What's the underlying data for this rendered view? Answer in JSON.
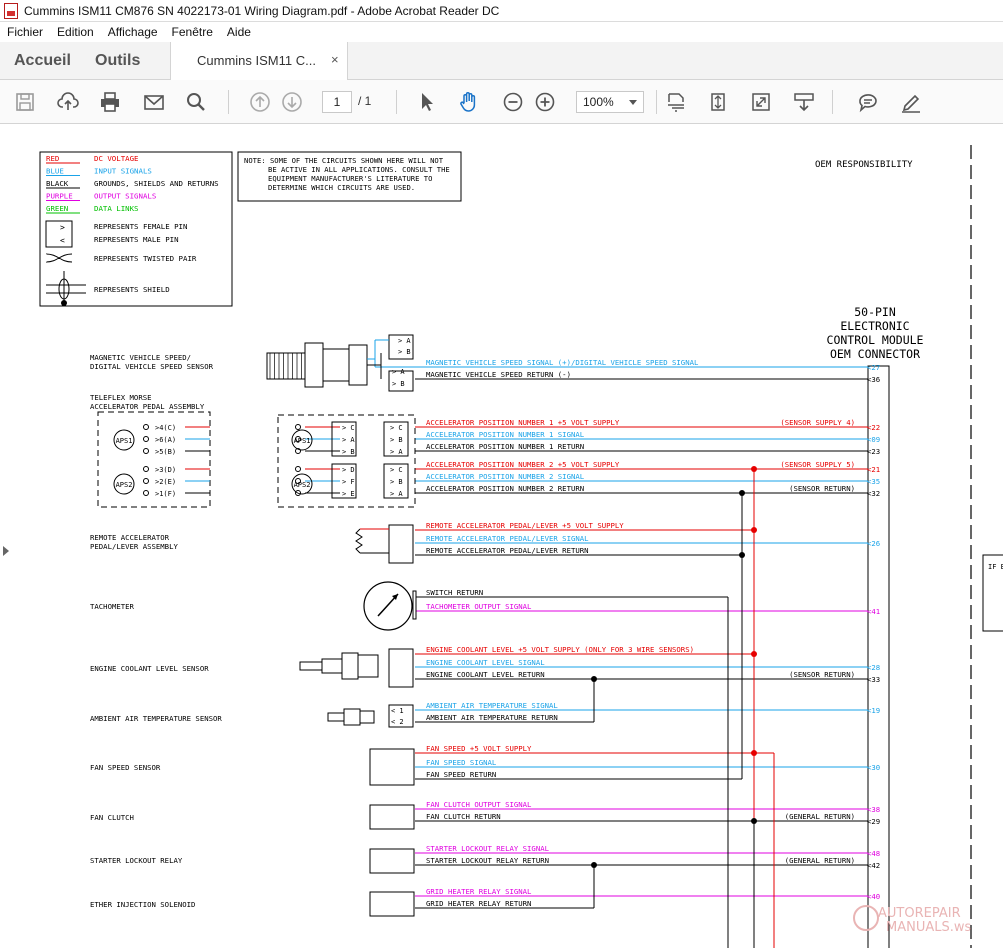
{
  "window": {
    "title": "Cummins ISM11 CM876 SN 4022173-01 Wiring Diagram.pdf - Adobe Acrobat Reader DC"
  },
  "menu": [
    "Fichier",
    "Edition",
    "Affichage",
    "Fenêtre",
    "Aide"
  ],
  "tabs": {
    "home": "Accueil",
    "tools": "Outils",
    "document": "Cummins ISM11 C...",
    "close": "×"
  },
  "toolbar": {
    "page_current": "1",
    "page_total": "/ 1",
    "zoom": "100%"
  },
  "legend": {
    "colors": [
      {
        "name": "RED",
        "meaning": "DC VOLTAGE",
        "hex": "#e60000"
      },
      {
        "name": "BLUE",
        "meaning": "INPUT SIGNALS",
        "hex": "#1aa3e8"
      },
      {
        "name": "BLACK",
        "meaning": "GROUNDS, SHIELDS AND RETURNS",
        "hex": "#000000"
      },
      {
        "name": "PURPLE",
        "meaning": "OUTPUT SIGNALS",
        "hex": "#e000e0"
      },
      {
        "name": "GREEN",
        "meaning": "DATA LINKS",
        "hex": "#00c000"
      }
    ],
    "symbols": [
      "REPRESENTS FEMALE PIN",
      "REPRESENTS MALE PIN",
      "REPRESENTS TWISTED PAIR",
      "REPRESENTS SHIELD"
    ]
  },
  "note": [
    "NOTE: SOME OF THE CIRCUITS SHOWN HERE WILL NOT",
    "BE ACTIVE IN ALL APPLICATIONS. CONSULT THE",
    "EQUIPMENT MANUFACTURER'S LITERATURE TO",
    "DETERMINE WHICH CIRCUITS ARE USED."
  ],
  "oem_responsibility": "OEM RESPONSIBILITY",
  "connector_title": [
    "50-PIN",
    "ELECTRONIC",
    "CONTROL MODULE",
    "OEM CONNECTOR"
  ],
  "components": [
    [
      "MAGNETIC VEHICLE SPEED/",
      "DIGITAL VEHICLE SPEED SENSOR"
    ],
    [
      "TELEFLEX MORSE",
      "ACCELERATOR PEDAL ASSEMBLY"
    ],
    [
      "REMOTE ACCELERATOR",
      "PEDAL/LEVER ASSEMBLY"
    ],
    [
      "TACHOMETER"
    ],
    [
      "ENGINE COOLANT LEVEL SENSOR"
    ],
    [
      "AMBIENT AIR TEMPERATURE SENSOR"
    ],
    [
      "FAN SPEED SENSOR"
    ],
    [
      "FAN CLUTCH"
    ],
    [
      "STARTER LOCKOUT RELAY"
    ],
    [
      "ETHER INJECTION SOLENOID"
    ]
  ],
  "wires": [
    {
      "label": "MAGNETIC VEHICLE SPEED SIGNAL (+)/DIGITAL VEHICLE SPEED SIGNAL",
      "color": "blue",
      "pin": "<27",
      "note": ""
    },
    {
      "label": "MAGNETIC VEHICLE SPEED RETURN (-)",
      "color": "black",
      "pin": "<36",
      "note": ""
    },
    {
      "label": "ACCELERATOR POSITION NUMBER 1 +5 VOLT SUPPLY",
      "color": "red",
      "pin": "<22",
      "note": "(SENSOR SUPPLY 4)"
    },
    {
      "label": "ACCELERATOR POSITION NUMBER 1 SIGNAL",
      "color": "blue",
      "pin": "<09",
      "note": ""
    },
    {
      "label": "ACCELERATOR POSITION NUMBER 1 RETURN",
      "color": "black",
      "pin": "<23",
      "note": ""
    },
    {
      "label": "ACCELERATOR POSITION NUMBER 2 +5 VOLT SUPPLY",
      "color": "red",
      "pin": "<21",
      "note": "(SENSOR SUPPLY 5)"
    },
    {
      "label": "ACCELERATOR POSITION NUMBER 2 SIGNAL",
      "color": "blue",
      "pin": "<35",
      "note": ""
    },
    {
      "label": "ACCELERATOR POSITION NUMBER 2 RETURN",
      "color": "black",
      "pin": "<32",
      "note": "(SENSOR RETURN)"
    },
    {
      "label": "REMOTE ACCELERATOR PEDAL/LEVER +5 VOLT SUPPLY",
      "color": "red",
      "pin": "",
      "note": ""
    },
    {
      "label": "REMOTE ACCELERATOR PEDAL/LEVER SIGNAL",
      "color": "blue",
      "pin": "<26",
      "note": ""
    },
    {
      "label": "REMOTE ACCELERATOR PEDAL/LEVER RETURN",
      "color": "black",
      "pin": "",
      "note": ""
    },
    {
      "label": "SWITCH RETURN",
      "color": "black",
      "pin": "",
      "note": ""
    },
    {
      "label": "TACHOMETER OUTPUT SIGNAL",
      "color": "purple",
      "pin": "<41",
      "note": ""
    },
    {
      "label": "ENGINE COOLANT LEVEL +5 VOLT SUPPLY (ONLY FOR 3 WIRE SENSORS)",
      "color": "red",
      "pin": "",
      "note": ""
    },
    {
      "label": "ENGINE COOLANT LEVEL SIGNAL",
      "color": "blue",
      "pin": "<28",
      "note": ""
    },
    {
      "label": "ENGINE COOLANT LEVEL RETURN",
      "color": "black",
      "pin": "<33",
      "note": "(SENSOR RETURN)"
    },
    {
      "label": "AMBIENT AIR TEMPERATURE SIGNAL",
      "color": "blue",
      "pin": "<19",
      "note": ""
    },
    {
      "label": "AMBIENT AIR TEMPERATURE RETURN",
      "color": "black",
      "pin": "",
      "note": ""
    },
    {
      "label": "FAN SPEED +5 VOLT SUPPLY",
      "color": "red",
      "pin": "",
      "note": ""
    },
    {
      "label": "FAN SPEED SIGNAL",
      "color": "blue",
      "pin": "<30",
      "note": ""
    },
    {
      "label": "FAN SPEED RETURN",
      "color": "black",
      "pin": "",
      "note": ""
    },
    {
      "label": "FAN CLUTCH OUTPUT SIGNAL",
      "color": "purple",
      "pin": "<38",
      "note": ""
    },
    {
      "label": "FAN CLUTCH RETURN",
      "color": "black",
      "pin": "<29",
      "note": "(GENERAL RETURN)"
    },
    {
      "label": "STARTER LOCKOUT RELAY SIGNAL",
      "color": "purple",
      "pin": "<48",
      "note": ""
    },
    {
      "label": "STARTER LOCKOUT RELAY RETURN",
      "color": "black",
      "pin": "<42",
      "note": "(GENERAL RETURN)"
    },
    {
      "label": "GRID HEATER RELAY SIGNAL",
      "color": "purple",
      "pin": "<40",
      "note": ""
    },
    {
      "label": "GRID HEATER RELAY RETURN",
      "color": "black",
      "pin": "",
      "note": ""
    }
  ],
  "pedal_pins": {
    "left": [
      "4(C)",
      "6(A)",
      "5(B)",
      "3(D)",
      "2(E)",
      "1(F)"
    ],
    "aps": [
      "APS1",
      "APS2"
    ],
    "conn_a": [
      "C",
      "A",
      "B",
      "D",
      "F",
      "E"
    ],
    "conn_b": [
      "C",
      "B",
      "A",
      "C",
      "B",
      "A"
    ],
    "speed_pins": [
      "A",
      "B"
    ],
    "temp_pins": [
      "1",
      "2"
    ]
  },
  "right_edge": {
    "box_text": "IF E"
  },
  "watermark": [
    "AUTOREPAIR",
    "MANUALS.ws"
  ],
  "colors": {
    "red": "#e60000",
    "blue": "#1aa3e8",
    "black": "#000000",
    "purple": "#e000e0",
    "green": "#00c000"
  }
}
